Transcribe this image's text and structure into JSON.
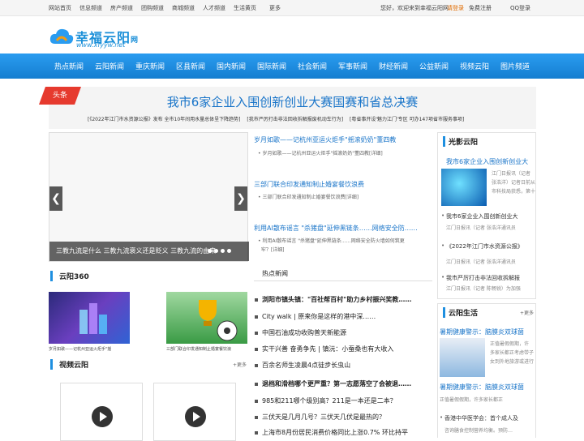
{
  "topbar": {
    "links": [
      "网站首页",
      "信息频道",
      "房产频道",
      "团购频道",
      "商城频道",
      "人才频道",
      "生活黄页",
      "更多"
    ],
    "welcome": "您好，欢迎来到幸福云阳网",
    "login": "请登录",
    "register": "免费注册",
    "qq": "QQ登录"
  },
  "logo": {
    "name": "幸福云阳",
    "suffix": "网",
    "url": "www.xfyyw.net"
  },
  "nav": [
    "热点新闻",
    "云阳新闻",
    "重庆新闻",
    "区县新闻",
    "国内新闻",
    "国际新闻",
    "社会新闻",
    "军事新闻",
    "财经新闻",
    "公益新闻",
    "视频云阳",
    "图片频道"
  ],
  "headline": {
    "tag": "头条",
    "title": "我市6家企业入围创新创业大赛国赛和省总决赛",
    "sub1": "[《2022年江门市水资源公报》发布 全市10年间用水量总体呈下降趋势]",
    "sub2": "[我市严厉打击非法回收拆解报废机动车行为]",
    "sub3": "[粤省事开设'魅力江门'专区 可办147项省市服务事项]"
  },
  "slider": {
    "caption": "三教九流是什么 三教九流褒义还是贬义 三教九流的由来",
    "prev": "❮",
    "next": "❯"
  },
  "news": [
    {
      "title": "岁月如歌——记杭州亚运火炬手\"摇滚奶奶\"董四教",
      "desc": "岁月如歌——记杭州亚运火炬手\"摇滚奶奶\"董四教[详细]"
    },
    {
      "title": "三部门联合印发通知制止婚宴餐饮浪费",
      "desc": "三部门联合印发通知制止婚宴餐饮浪费[详细]"
    },
    {
      "title": "利用AI散布谣言 \"杀猪盘\"延伸黑链条……网络安全防……",
      "desc1": "利用AI散布谣言 \"杀猪盘\"延伸黑链条……网络安全防火墙如何筑更",
      "desc2": "牢？[详细]"
    }
  ],
  "yunyang360": {
    "title": "云阳360",
    "more": "更多",
    "cap1": "岁月如歌——记杭州亚运火炬手\"摇",
    "cap2": "三部门联合印发通知制止婚宴餐饮浪"
  },
  "video": {
    "title": "视频云阳",
    "more": "更多"
  },
  "hot": {
    "tab": "热点新闻",
    "items": [
      "浏阳市镇头镇：\"百社帮百村\"助力乡村振兴奖教……",
      "City walk | 原来你是这样的港中深……",
      "中国石油成功收购普天新能源",
      "实干兴善 奋勇争先 | 镇沅：小蚕桑也有大收入",
      "百余名师生凌晨4点徒步长虫山",
      "退档和滑档哪个更严重？第一志愿落空了会被退……",
      "985和211哪个级别高？211是一本还是二本？",
      "三伏天是几月几号？三伏天几伏是最热的？",
      "上海市8月份居民消费价格同比上涨0.7% 环比持平"
    ]
  },
  "guangying": {
    "title": "光影云阳",
    "lead": "我市6家企业入围创新创业大",
    "s1": "江门日报讯（记者",
    "s2": "张浩洋）记者日前从",
    "s3": "市科技局获悉，第十",
    "l1": "我市6家企业入围创新创业大",
    "l2": "《2022年江门市水资源公报》",
    "l3": "江门日报讯（记者 张浩洋通讯员",
    "l4": "我市严厉打击非法回收拆解报",
    "l5": "江门日报讯（记者 陈畅锐）为加强"
  },
  "shenghuo": {
    "title": "云阳生活",
    "more": "更多",
    "lead": "暑期健康警示：脑膜炎双球菌",
    "s1": "正值暑假假期，许",
    "s2": "多家长都正考虑带子",
    "s3": "女到外地旅游或进行",
    "l1": "暑期健康警示：脑膜炎双球菌",
    "l2": "正值暑假假期，许多家长都正",
    "l3": "香港中华医学会：首个成人及",
    "l4": "咨询膳食控制营养均衡。预防…"
  }
}
